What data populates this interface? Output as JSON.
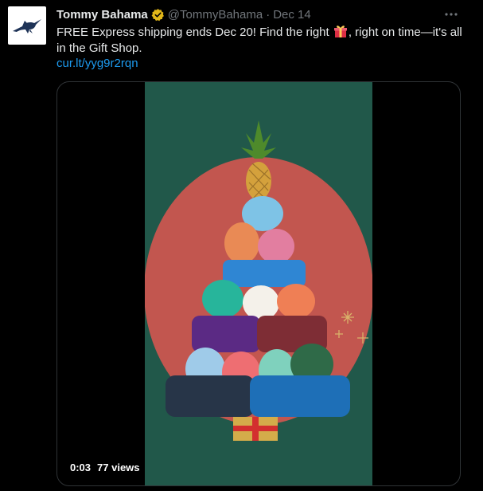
{
  "tweet": {
    "display_name": "Tommy Bahama",
    "handle": "@TommyBahama",
    "separator": "·",
    "date": "Dec 14",
    "text_before_emoji": "FREE Express shipping ends Dec 20! Find the right ",
    "text_after_emoji": ", right on time—it's all in the Gift Shop.",
    "emoji_icon": "wrapped-gift-icon",
    "link": "cur.lt/yyg9r2rqn",
    "more_icon": "more-options-icon",
    "verified_icon": "verified-badge-icon",
    "avatar_icon": "marlin-logo-icon"
  },
  "video": {
    "elapsed": "0:03",
    "views": "77 views"
  },
  "colors": {
    "background": "#000000",
    "text": "#e7e9ea",
    "muted": "#71767b",
    "link": "#1d9bf0",
    "verified_gold": "#e2b719",
    "video_green": "#21584a",
    "circle_red": "#c2564f"
  }
}
